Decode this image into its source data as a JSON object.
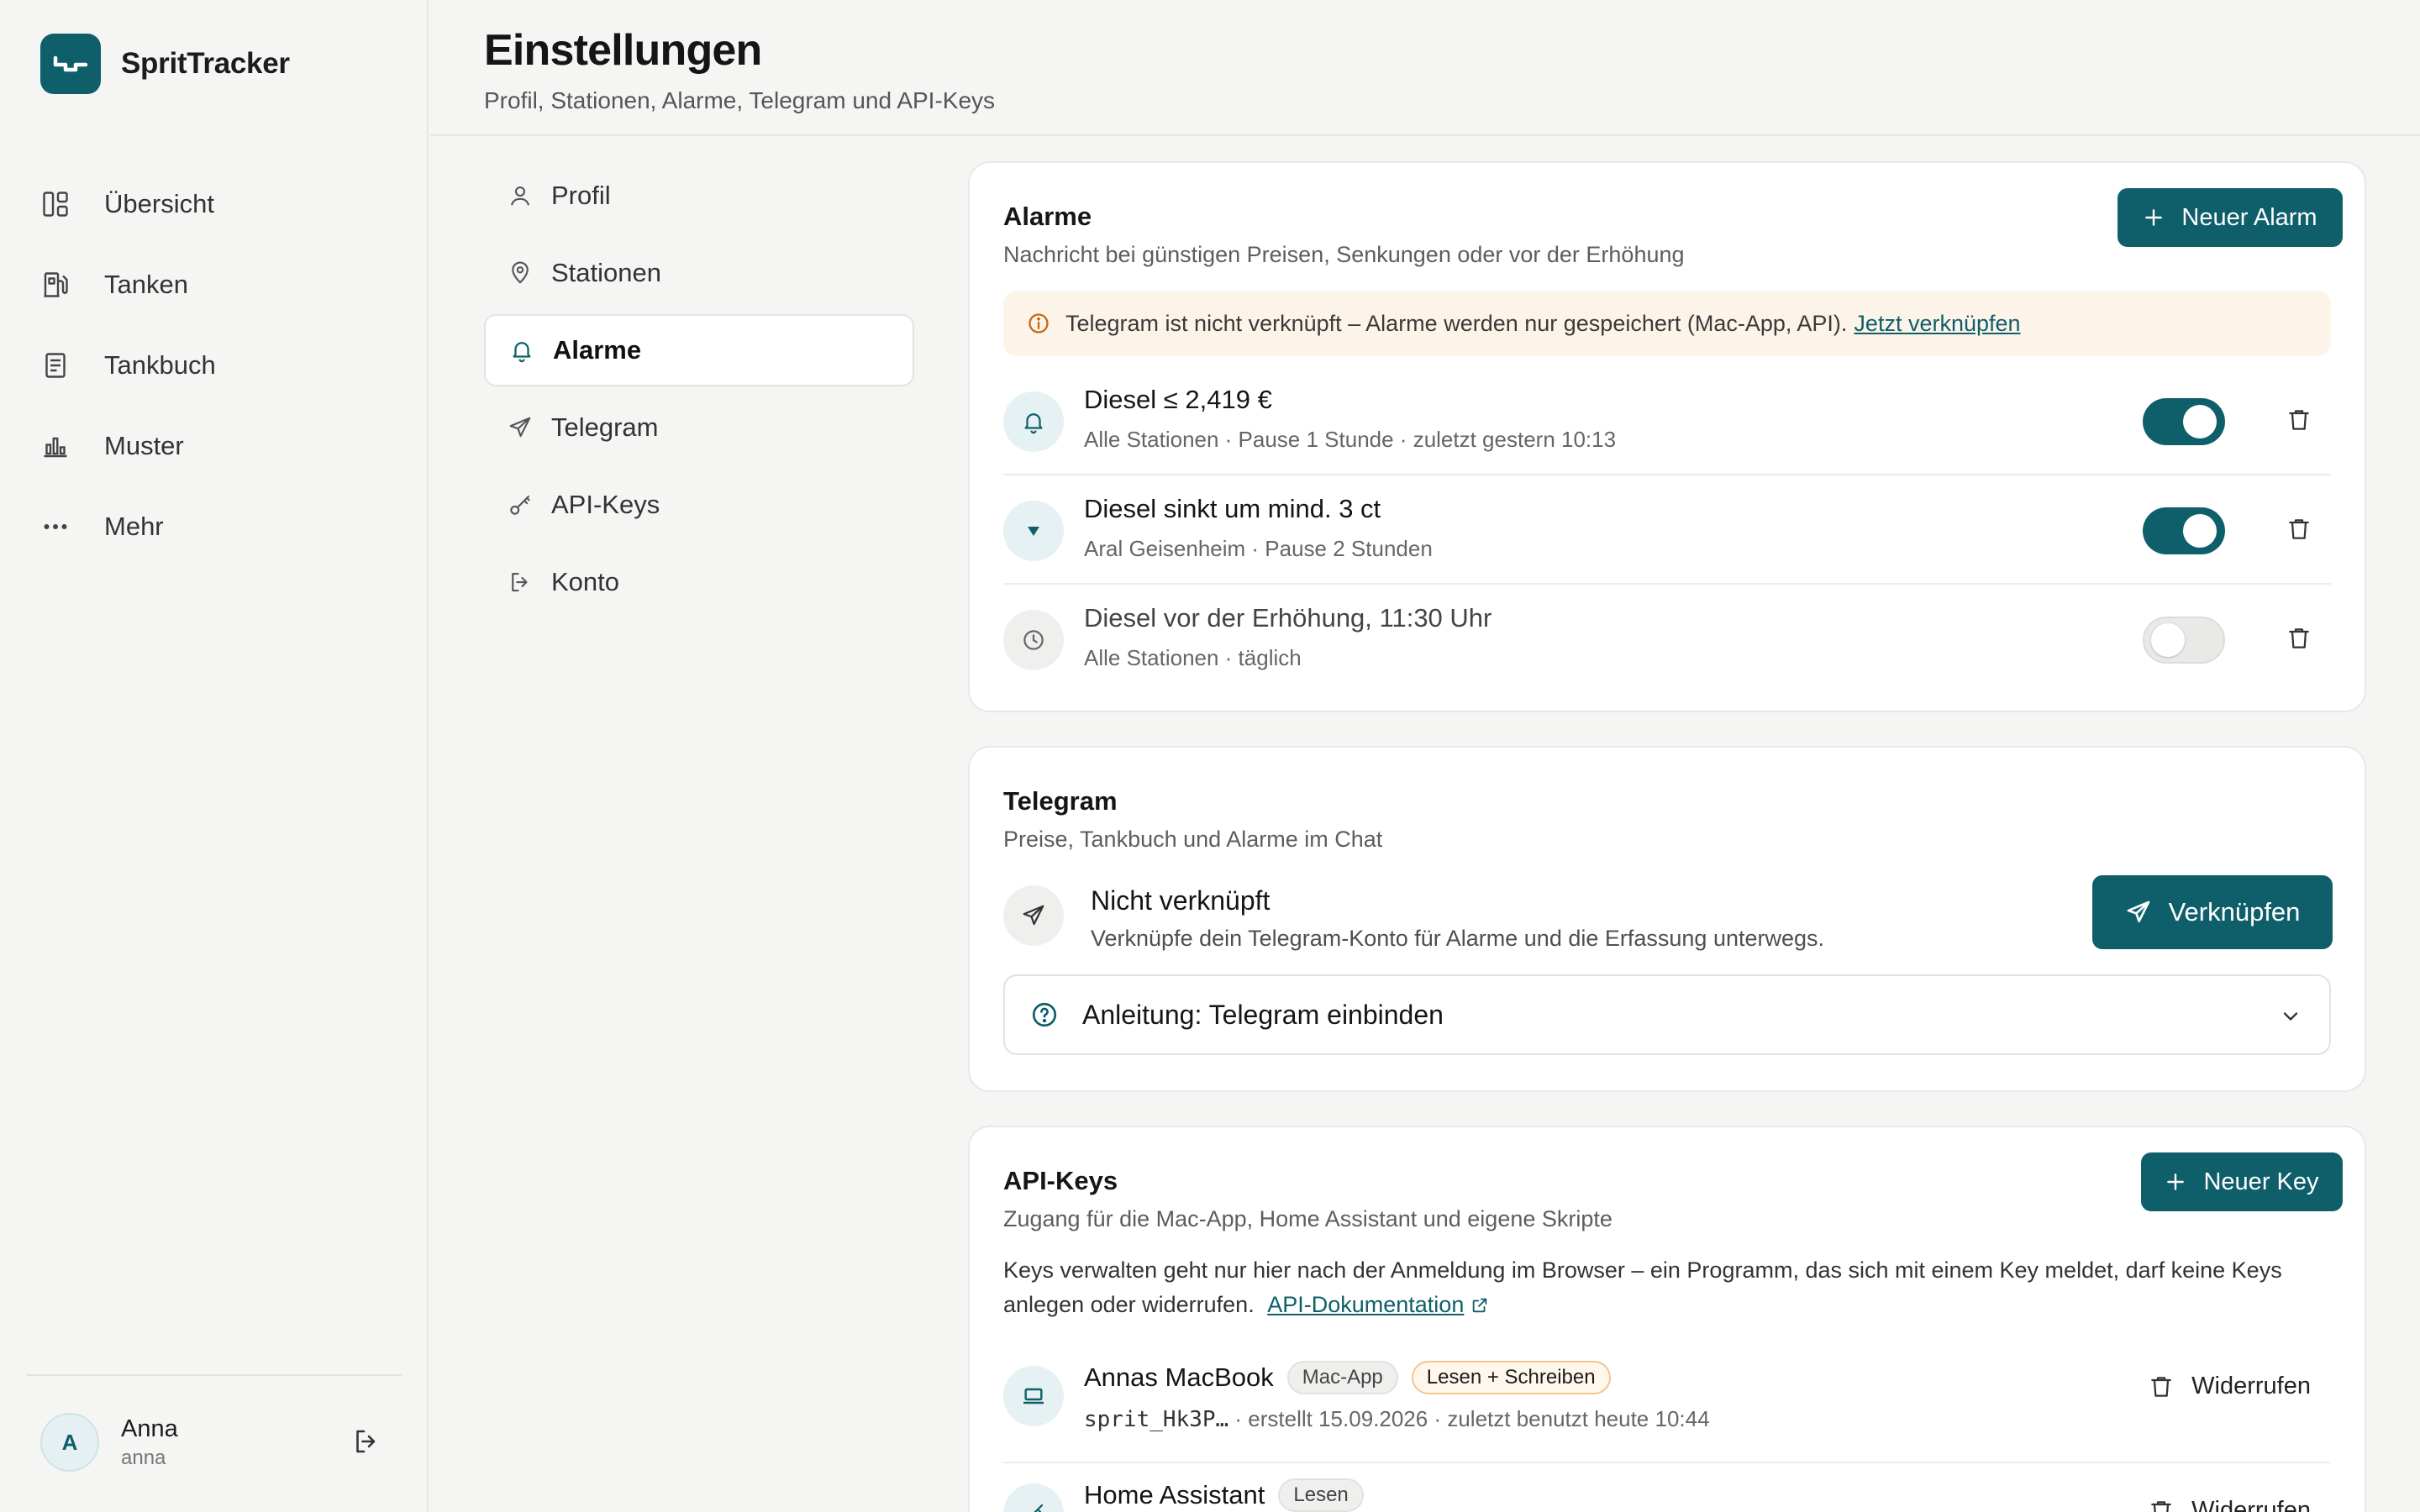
{
  "app": {
    "name": "SpritTracker"
  },
  "sidebar": {
    "items": [
      {
        "label": "Übersicht",
        "icon": "dashboard-icon"
      },
      {
        "label": "Tanken",
        "icon": "fuel-pump-icon"
      },
      {
        "label": "Tankbuch",
        "icon": "logbook-icon"
      },
      {
        "label": "Muster",
        "icon": "bar-chart-icon"
      },
      {
        "label": "Mehr",
        "icon": "more-icon"
      }
    ],
    "user": {
      "initial": "A",
      "name": "Anna",
      "handle": "anna"
    }
  },
  "header": {
    "title": "Einstellungen",
    "subtitle": "Profil, Stationen, Alarme, Telegram und API-Keys"
  },
  "settings_nav": {
    "active": "Alarme",
    "items": [
      {
        "label": "Profil",
        "icon": "user-icon"
      },
      {
        "label": "Stationen",
        "icon": "map-pin-icon"
      },
      {
        "label": "Alarme",
        "icon": "bell-icon"
      },
      {
        "label": "Telegram",
        "icon": "send-icon"
      },
      {
        "label": "API-Keys",
        "icon": "key-icon"
      },
      {
        "label": "Konto",
        "icon": "logout-icon"
      }
    ]
  },
  "alarms": {
    "title": "Alarme",
    "subtitle": "Nachricht bei günstigen Preisen, Senkungen oder vor der Erhöhung",
    "new_button": "Neuer Alarm",
    "banner": {
      "text": "Telegram ist nicht verknüpft – Alarme werden nur gespeichert (Mac-App, API).",
      "link": "Jetzt verknüpfen"
    },
    "items": [
      {
        "title": "Diesel ≤ 2,419 €",
        "meta": "Alle Stationen · Pause 1 Stunde · zuletzt gestern 10:13",
        "enabled": true,
        "icon": "bell-icon"
      },
      {
        "title": "Diesel sinkt um mind. 3 ct",
        "meta": "Aral Geisenheim · Pause 2 Stunden",
        "enabled": true,
        "icon": "triangle-down-icon"
      },
      {
        "title": "Diesel vor der Erhöhung, 11:30 Uhr",
        "meta": "Alle Stationen · täglich",
        "enabled": false,
        "icon": "clock-icon"
      }
    ]
  },
  "telegram": {
    "title": "Telegram",
    "subtitle": "Preise, Tankbuch und Alarme im Chat",
    "status_title": "Nicht verknüpft",
    "status_desc": "Verknüpfe dein Telegram-Konto für Alarme und die Erfassung unterwegs.",
    "link_button": "Verknüpfen",
    "guide": "Anleitung: Telegram einbinden"
  },
  "api_keys": {
    "title": "API-Keys",
    "subtitle": "Zugang für die Mac-App, Home Assistant und eigene Skripte",
    "new_button": "Neuer Key",
    "note": "Keys verwalten geht nur hier nach der Anmeldung im Browser – ein Programm, das sich mit einem Key meldet, darf keine Keys anlegen oder widerrufen.",
    "docs_link": "API-Dokumentation",
    "keys": [
      {
        "name": "Annas MacBook",
        "badges": [
          "Mac-App",
          "Lesen + Schreiben"
        ],
        "prefix": "sprit_Hk3P…",
        "meta": " · erstellt 15.09.2026 · zuletzt benutzt heute 10:44",
        "revoke": "Widerrufen",
        "icon": "laptop-icon"
      },
      {
        "name": "Home Assistant",
        "badges": [
          "Lesen"
        ],
        "revoke": "Widerrufen",
        "icon": "key-icon"
      }
    ]
  },
  "colors": {
    "accent": "#0f5f6b",
    "banner_bg": "#fdf4e9",
    "warning": "#c46a10"
  }
}
